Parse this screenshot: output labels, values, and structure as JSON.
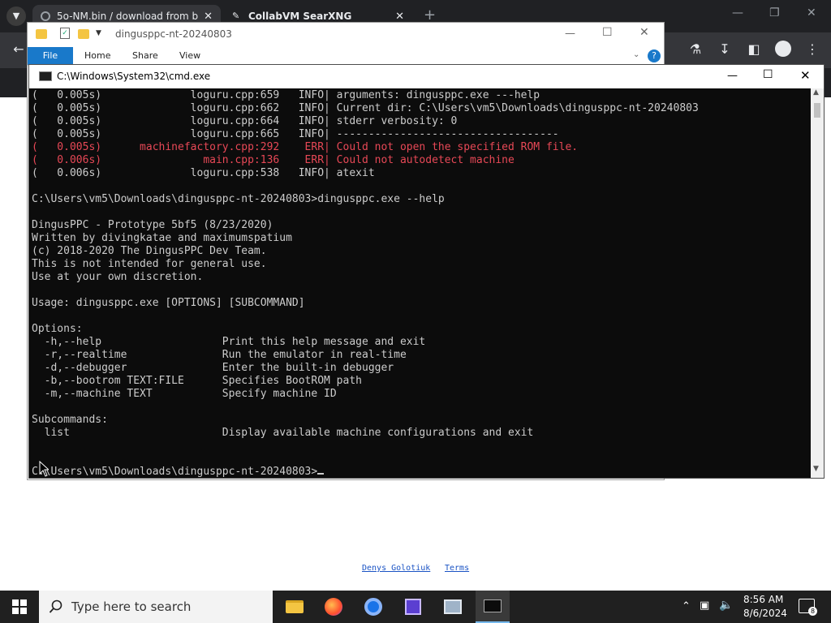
{
  "browser": {
    "tabs": [
      {
        "title": "5o-NM.bin / download from b",
        "active": true
      },
      {
        "title": "CollabVM SearXNG",
        "active": false
      }
    ],
    "new_tab_symbol": "+"
  },
  "explorer": {
    "title": "dingusppc-nt-20240803",
    "ribbon": [
      "File",
      "Home",
      "Share",
      "View"
    ]
  },
  "cmd": {
    "title": "C:\\Windows\\System32\\cmd.exe",
    "lines": [
      {
        "text": "(   0.005s)              loguru.cpp:659   INFO| arguments: dingusppc.exe ---help",
        "error": false
      },
      {
        "text": "(   0.005s)              loguru.cpp:662   INFO| Current dir: C:\\Users\\vm5\\Downloads\\dingusppc-nt-20240803",
        "error": false
      },
      {
        "text": "(   0.005s)              loguru.cpp:664   INFO| stderr verbosity: 0",
        "error": false
      },
      {
        "text": "(   0.005s)              loguru.cpp:665   INFO| -----------------------------------",
        "error": false
      },
      {
        "text": "(   0.005s)      machinefactory.cpp:292    ERR| Could not open the specified ROM file.",
        "error": true
      },
      {
        "text": "(   0.006s)                main.cpp:136    ERR| Could not autodetect machine",
        "error": true
      },
      {
        "text": "(   0.006s)              loguru.cpp:538   INFO| atexit",
        "error": false
      },
      {
        "text": "",
        "error": false
      },
      {
        "text": "C:\\Users\\vm5\\Downloads\\dingusppc-nt-20240803>dingusppc.exe --help",
        "error": false
      },
      {
        "text": "",
        "error": false
      },
      {
        "text": "DingusPPC - Prototype 5bf5 (8/23/2020)",
        "error": false
      },
      {
        "text": "Written by divingkatae and maximumspatium",
        "error": false
      },
      {
        "text": "(c) 2018-2020 The DingusPPC Dev Team.",
        "error": false
      },
      {
        "text": "This is not intended for general use.",
        "error": false
      },
      {
        "text": "Use at your own discretion.",
        "error": false
      },
      {
        "text": "",
        "error": false
      },
      {
        "text": "Usage: dingusppc.exe [OPTIONS] [SUBCOMMAND]",
        "error": false
      },
      {
        "text": "",
        "error": false
      },
      {
        "text": "Options:",
        "error": false
      },
      {
        "text": "  -h,--help                   Print this help message and exit",
        "error": false
      },
      {
        "text": "  -r,--realtime               Run the emulator in real-time",
        "error": false
      },
      {
        "text": "  -d,--debugger               Enter the built-in debugger",
        "error": false
      },
      {
        "text": "  -b,--bootrom TEXT:FILE      Specifies BootROM path",
        "error": false
      },
      {
        "text": "  -m,--machine TEXT           Specify machine ID",
        "error": false
      },
      {
        "text": "",
        "error": false
      },
      {
        "text": "Subcommands:",
        "error": false
      },
      {
        "text": "  list                        Display available machine configurations and exit",
        "error": false
      },
      {
        "text": "",
        "error": false
      },
      {
        "text": "",
        "error": false
      }
    ],
    "prompt": "C:\\Users\\vm5\\Downloads\\dingusppc-nt-20240803>"
  },
  "page_footer": {
    "author_link": "Denys Golotiuk",
    "terms_link": "Terms"
  },
  "taskbar": {
    "search_placeholder": "Type here to search",
    "time": "8:56 AM",
    "date": "8/6/2024",
    "notification_count": "8"
  },
  "colors": {
    "terminal_bg": "#0c0c0c",
    "terminal_fg": "#cccccc",
    "error_fg": "#e74856",
    "taskbar_bg": "#202020",
    "explorer_accent": "#1979ca"
  }
}
